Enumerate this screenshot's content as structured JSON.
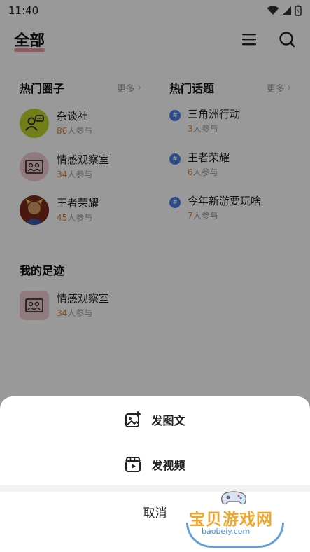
{
  "status_bar": {
    "time": "11:40"
  },
  "header": {
    "title": "全部"
  },
  "hot_circles": {
    "title": "热门圈子",
    "more": "更多",
    "items": [
      {
        "name": "杂谈社",
        "count": "86",
        "suffix": "人参与",
        "avatar_color": "#bed42a",
        "icon": "chat-user-icon"
      },
      {
        "name": "情感观察室",
        "count": "34",
        "suffix": "人参与",
        "avatar_color": "#f2ccd0",
        "icon": "photo-frame-icon"
      },
      {
        "name": "王者荣耀",
        "count": "45",
        "suffix": "人参与",
        "avatar_color": "#8a3320",
        "icon": "game-hero-avatar"
      }
    ]
  },
  "hot_topics": {
    "title": "热门话题",
    "more": "更多",
    "items": [
      {
        "name": "三角洲行动",
        "count": "3",
        "suffix": "人参与"
      },
      {
        "name": "王者荣耀",
        "count": "6",
        "suffix": "人参与"
      },
      {
        "name": "今年新游要玩啥",
        "count": "7",
        "suffix": "人参与"
      }
    ]
  },
  "footprint": {
    "title": "我的足迹",
    "items": [
      {
        "name": "情感观察室",
        "count": "34",
        "suffix": "人参与",
        "avatar_color": "#f2ccd0",
        "icon": "photo-frame-icon"
      }
    ]
  },
  "sheet": {
    "post_image": "发图文",
    "post_video": "发视频",
    "cancel": "取消"
  },
  "watermark": {
    "text": "宝贝游戏网",
    "url": "baobeiy.com"
  }
}
